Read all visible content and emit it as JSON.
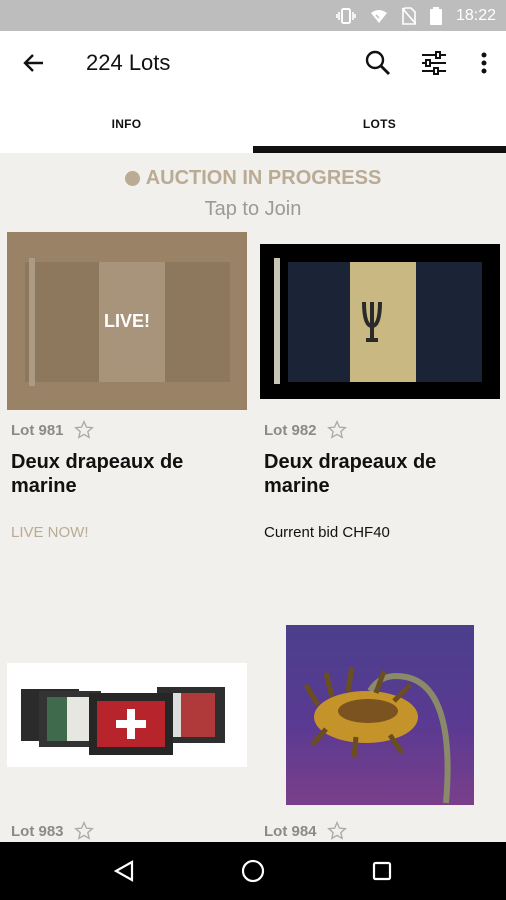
{
  "status_bar": {
    "time": "18:22",
    "icons": [
      "vibrate-icon",
      "wifi-icon",
      "no-sim-icon",
      "battery-icon"
    ]
  },
  "app_bar": {
    "title": "224 Lots",
    "actions": [
      "back-arrow-icon",
      "search-icon",
      "filter-icon",
      "more-vert-icon"
    ]
  },
  "tabs": [
    {
      "label": "INFO",
      "active": false
    },
    {
      "label": "LOTS",
      "active": true
    }
  ],
  "banner": {
    "status": "AUCTION IN PROGRESS",
    "cta": "Tap to Join",
    "accent": "#b9ab94"
  },
  "lots": [
    {
      "number": "Lot 981",
      "title": "Deux drapeaux de marine",
      "status": "LIVE NOW!",
      "overlay": "LIVE!"
    },
    {
      "number": "Lot 982",
      "title": "Deux drapeaux de marine",
      "status": "Current bid CHF40"
    },
    {
      "number": "Lot 983"
    },
    {
      "number": "Lot 984"
    }
  ],
  "nav_bar": {
    "buttons": [
      "back-triangle-icon",
      "home-circle-icon",
      "recents-square-icon"
    ]
  }
}
